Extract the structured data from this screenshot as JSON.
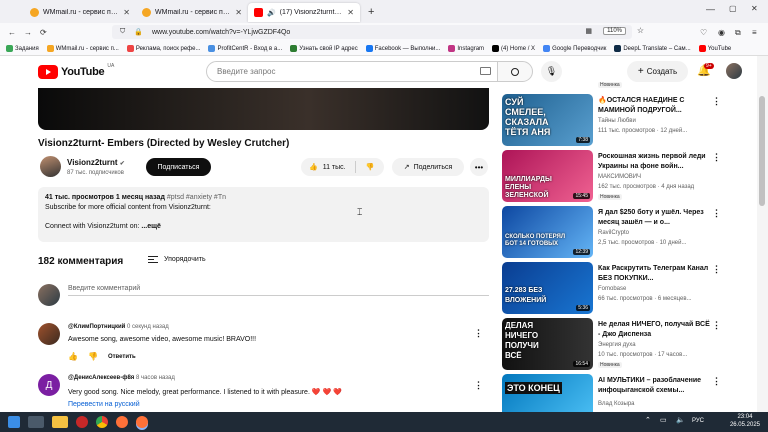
{
  "browser": {
    "tabs": [
      {
        "title": "WMmail.ru - сервис почтовых",
        "active": false,
        "favicon_color": "#f5a623"
      },
      {
        "title": "WMmail.ru - сервис почтовых",
        "active": false,
        "favicon_color": "#f5a623"
      },
      {
        "title": "(17) Visionz2turnt- Embers",
        "active": true,
        "favicon_color": "#ff0000"
      }
    ],
    "new_tab": "+",
    "url": "www.youtube.com/watch?v=-YLjwGZDF4Qo",
    "zoom": "110%",
    "bookmarks": [
      {
        "label": "Задания",
        "color": "#3aa757"
      },
      {
        "label": "WMmail.ru - сервис п...",
        "color": "#f5a623"
      },
      {
        "label": "Реклама, поиск рефе...",
        "color": "#e44"
      },
      {
        "label": "ProfitCentR - Вход в а...",
        "color": "#4a90e2"
      },
      {
        "label": "Узнать свой IP адрес",
        "color": "#2e7d32"
      },
      {
        "label": "Facebook — Выполни...",
        "color": "#1877f2"
      },
      {
        "label": "Instagram",
        "color": "#c13584"
      },
      {
        "label": "(4) Home / X",
        "color": "#000000"
      },
      {
        "label": "Google Переводчик",
        "color": "#4285f4"
      },
      {
        "label": "DeepL Translate – Сам...",
        "color": "#0f2b46"
      },
      {
        "label": "YouTube",
        "color": "#ff0000"
      }
    ]
  },
  "yt": {
    "logo_word": "YouTube",
    "logo_region": "UA",
    "search_placeholder": "Введите запрос",
    "create_label": "Создать",
    "notif_count": "9+"
  },
  "video": {
    "title": "Visionz2turnt- Embers (Directed by Wesley Crutcher)",
    "channel": "Visionz2turnt",
    "verified": "✔",
    "subscribers": "87 тыс. подписчиков",
    "subscribe_label": "Подписаться",
    "likes": "11 тыс.",
    "share_label": "Поделиться",
    "views_date": "41 тыс. просмотров  1 месяц назад",
    "hashtags": "#ptsd #anxiety #Tn",
    "desc_line1": "Subscribe for more official content from Visionz2turnt:",
    "desc_line2": "Connect with Visionz2turnt on:",
    "desc_more": "...ещё"
  },
  "comments": {
    "count_label": "182 комментария",
    "sort_label": "Упорядочить",
    "add_placeholder": "Введите комментарий",
    "items": [
      {
        "author": "@КлимПортницкий",
        "time": "0 секунд назад",
        "text": "Awesome song, awesome video, awesome music! BRAVO!!!",
        "reply_label": "Ответить",
        "avatar_color": "#a0522d",
        "avatar_letter": ""
      },
      {
        "author": "@ДенисАлексеев-ф8я",
        "time": "8 часов назад",
        "text": "Very good song. Nice melody, great performance. I listened to it with pleasure. ❤️ ❤️ ❤️",
        "reply_label": "Ответить",
        "avatar_color": "#7b1fa2",
        "avatar_letter": "Д"
      }
    ],
    "translate_label": "Перевести на русский"
  },
  "recommendations": [
    {
      "title": "",
      "channel": "",
      "meta": "",
      "badge": "Новинка",
      "thumb_text": "",
      "duration": "",
      "thumb_bg": "#444444"
    },
    {
      "title": "🔥ОСТАЛСЯ НАЕДИНЕ С МАМИНОЙ ПОДРУГОЙ...",
      "channel": "Тайны Любви",
      "meta": "111 тыс. просмотров · 12 дней...",
      "badge": "",
      "thumb_text": "СУЙ СМЕЛЕЕ, СКАЗАЛА ТЁТЯ АНЯ",
      "duration": "7:38",
      "thumb_bg": "#2a6fa8"
    },
    {
      "title": "Роскошная жизнь первой леди Украины на фоне войн...",
      "channel": "МАКСИМОВИЧ",
      "meta": "162 тыс. просмотров · 4 дня назад",
      "badge": "Новинка",
      "thumb_text": "МИЛЛИАРДЫ ЕЛЕНЫ ЗЕЛЕНСКОЙ",
      "duration": "15:45",
      "thumb_bg": "#c2185b"
    },
    {
      "title": "Я дал $250 боту и ушёл. Через месяц зашёл — и о...",
      "channel": "RavilCrypto",
      "meta": "2,5 тыс. просмотров · 10 дней...",
      "badge": "",
      "thumb_text": "СКОЛЬКО ПОТЕРЯЛ БОТ 14 ГОТОВЫХ",
      "duration": "12:39",
      "thumb_bg": "#1565c0"
    },
    {
      "title": "Как Раскрутить Телеграм Канал БЕЗ ПОКУПКИ...",
      "channel": "Fomobase",
      "meta": "66 тыс. просмотров · 6 месяцев...",
      "badge": "",
      "thumb_text": "27.283 БЕЗ ВЛОЖЕНИЙ",
      "duration": "5:36",
      "thumb_bg": "#0d47a1"
    },
    {
      "title": "Не делая НИЧЕГО, получай ВСЁ - Джо Диспенза",
      "channel": "Энергия духа",
      "meta": "10 тыс. просмотров · 17 часов...",
      "badge": "Новинка",
      "thumb_text": "ДЕЛАЯ НИЧЕГО ПОЛУЧИ ВСЁ",
      "duration": "16:54",
      "thumb_bg": "#1a1a1a"
    },
    {
      "title": "AI МУЛЬТИКИ – разоблачение инфоцыганской схемы...",
      "channel": "Влад Козыра",
      "meta": "",
      "badge": "",
      "thumb_text": "ЭТО КОНЕЦ",
      "duration": "",
      "thumb_bg": "#0288d1"
    }
  ],
  "taskbar": {
    "time": "23:04",
    "date": "26.05.2025",
    "lang": "РУС"
  }
}
